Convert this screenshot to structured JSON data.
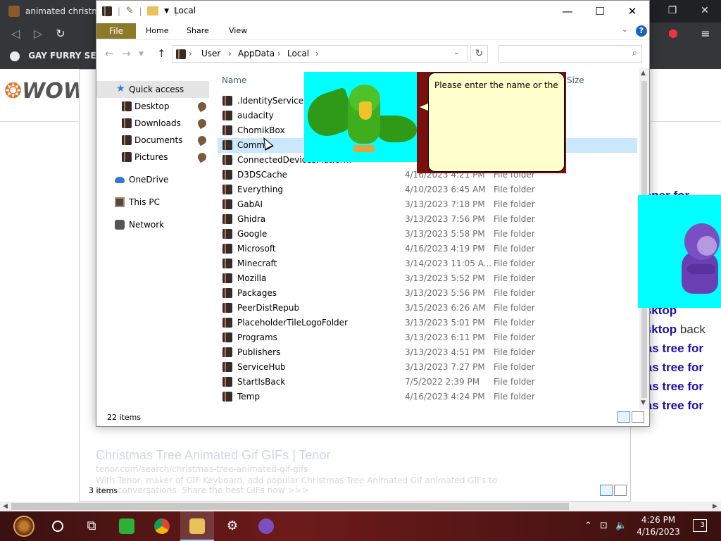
{
  "browser": {
    "tab_title": "animated christmas",
    "bookmark": "GAY FURRY SEX",
    "logo": "WOW",
    "right_texts": [
      {
        "bold": "llpaper for",
        "plain": ""
      },
      {
        "bold": "desktop",
        "plain": ""
      },
      {
        "bold": "desktop",
        "plain": " back"
      },
      {
        "bold": "tmas tree for",
        "plain": ""
      },
      {
        "bold": "tmas tree for",
        "plain": ""
      },
      {
        "bold": "tmas tree for",
        "plain": ""
      },
      {
        "bold": "tmas tree for",
        "plain": ""
      }
    ],
    "ghost_title": "Christmas Tree Animated Gif GIFs | Tenor",
    "ghost_url": "tenor.com/search/christmas-tree-animated-gif-gifs",
    "ghost_desc": "With Tenor, maker of GIF Keyboard, add popular Christmas Tree Animated Gif animated GIFs to your conversations. Share the best GIFs now >>>",
    "ghost_status": "3 items"
  },
  "explorer": {
    "title": "Local",
    "ribbon_tabs": {
      "file": "File",
      "home": "Home",
      "share": "Share",
      "view": "View"
    },
    "breadcrumb": [
      "User",
      "AppData",
      "Local"
    ],
    "search_placeholder": "",
    "nav": {
      "quick_access": "Quick access",
      "desktop": "Desktop",
      "downloads": "Downloads",
      "documents": "Documents",
      "pictures": "Pictures",
      "onedrive": "OneDrive",
      "this_pc": "This PC",
      "network": "Network"
    },
    "columns": {
      "name": "Name",
      "size": "Size"
    },
    "files": [
      {
        "name": ".IdentityService",
        "date": "",
        "type": ""
      },
      {
        "name": "audacity",
        "date": "",
        "type": ""
      },
      {
        "name": "ChomikBox",
        "date": "",
        "type": ""
      },
      {
        "name": "Comms",
        "date": "",
        "type": ""
      },
      {
        "name": "ConnectedDevicesPlatform",
        "date": "",
        "type": ""
      },
      {
        "name": "D3DSCache",
        "date": "4/16/2023 4:21 PM",
        "type": "File folder"
      },
      {
        "name": "Everything",
        "date": "4/10/2023 6:45 AM",
        "type": "File folder"
      },
      {
        "name": "GabAI",
        "date": "3/13/2023 7:18 PM",
        "type": "File folder"
      },
      {
        "name": "Ghidra",
        "date": "3/13/2023 7:56 PM",
        "type": "File folder"
      },
      {
        "name": "Google",
        "date": "3/13/2023 5:58 PM",
        "type": "File folder"
      },
      {
        "name": "Microsoft",
        "date": "4/16/2023 4:19 PM",
        "type": "File folder"
      },
      {
        "name": "Minecraft",
        "date": "3/14/2023 11:05 A...",
        "type": "File folder"
      },
      {
        "name": "Mozilla",
        "date": "3/13/2023 5:52 PM",
        "type": "File folder"
      },
      {
        "name": "Packages",
        "date": "3/13/2023 5:56 PM",
        "type": "File folder"
      },
      {
        "name": "PeerDistRepub",
        "date": "3/15/2023 6:26 AM",
        "type": "File folder"
      },
      {
        "name": "PlaceholderTileLogoFolder",
        "date": "3/13/2023 5:01 PM",
        "type": "File folder"
      },
      {
        "name": "Programs",
        "date": "3/13/2023 6:11 PM",
        "type": "File folder"
      },
      {
        "name": "Publishers",
        "date": "3/13/2023 4:51 PM",
        "type": "File folder"
      },
      {
        "name": "ServiceHub",
        "date": "3/13/2023 7:27 PM",
        "type": "File folder"
      },
      {
        "name": "StartIsBack",
        "date": "7/5/2022 2:39 PM",
        "type": "File folder"
      },
      {
        "name": "Temp",
        "date": "4/16/2023 4:24 PM",
        "type": "File folder"
      }
    ],
    "status": "22 items"
  },
  "assistant": {
    "speech": "Please enter the name or the"
  },
  "taskbar": {
    "time": "4:26 PM",
    "date": "4/16/2023",
    "notifications": "3"
  },
  "colors": {
    "file_tab": "#8b7a2a",
    "selection": "#cce8ff",
    "speech_bg": "#ffffcc",
    "cyan": "#00ffff"
  }
}
